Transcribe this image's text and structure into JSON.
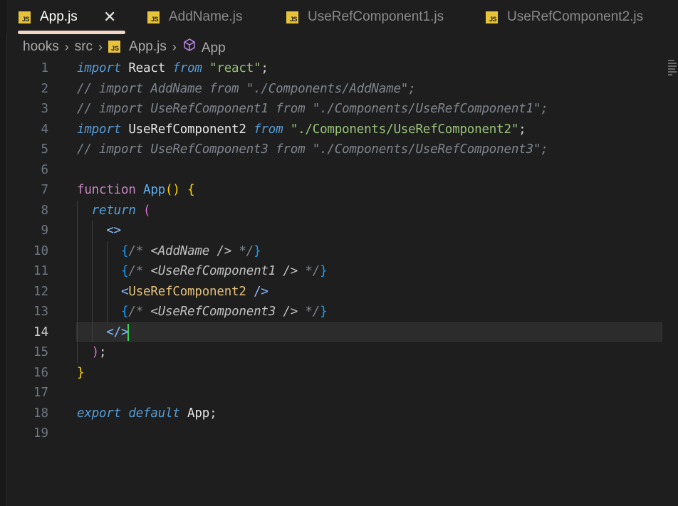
{
  "tabs": [
    {
      "label": "App.js",
      "icon": "js-file-icon",
      "badge": "JS",
      "active": true,
      "close": "✕"
    },
    {
      "label": "AddName.js",
      "icon": "js-file-icon",
      "badge": "JS",
      "active": false
    },
    {
      "label": "UseRefComponent1.js",
      "icon": "js-file-icon",
      "badge": "JS",
      "active": false
    },
    {
      "label": "UseRefComponent2.js",
      "icon": "js-file-icon",
      "badge": "JS",
      "active": false
    }
  ],
  "breadcrumb": {
    "items": [
      "hooks",
      "src",
      "App.js",
      "App"
    ],
    "separator": "›",
    "file_badge": "JS"
  },
  "editor": {
    "current_line": 14,
    "line_numbers": [
      "1",
      "2",
      "3",
      "4",
      "5",
      "6",
      "7",
      "8",
      "9",
      "10",
      "11",
      "12",
      "13",
      "14",
      "15",
      "16",
      "17",
      "18",
      "19"
    ],
    "lines": [
      [
        [
          "kw-it",
          "import"
        ],
        [
          "id",
          " React "
        ],
        [
          "kw-it",
          "from"
        ],
        [
          "str",
          " \"react\""
        ],
        [
          "punc",
          ";"
        ]
      ],
      [
        [
          "com",
          "// import AddName from \"./Components/AddName\";"
        ]
      ],
      [
        [
          "com",
          "// import UseRefComponent1 from \"./Components/UseRefComponent1\";"
        ]
      ],
      [
        [
          "kw-it",
          "import"
        ],
        [
          "id",
          " UseRefComponent2 "
        ],
        [
          "kw-it",
          "from"
        ],
        [
          "str",
          " \"./Components/UseRefComponent2\""
        ],
        [
          "punc",
          ";"
        ]
      ],
      [
        [
          "com",
          "// import UseRefComponent3 from \"./Components/UseRefComponent3\";"
        ]
      ],
      [],
      [
        [
          "fn",
          "function"
        ],
        [
          "id",
          " "
        ],
        [
          "fname",
          "App"
        ],
        [
          "br-y",
          "()"
        ],
        [
          "id",
          " "
        ],
        [
          "br-y",
          "{"
        ]
      ],
      [
        [
          "id",
          "  "
        ],
        [
          "kw-it",
          "return"
        ],
        [
          "id",
          " "
        ],
        [
          "br-p",
          "("
        ]
      ],
      [
        [
          "id",
          "    "
        ],
        [
          "tagp",
          "<>"
        ]
      ],
      [
        [
          "id",
          "      "
        ],
        [
          "br-b",
          "{"
        ],
        [
          "com",
          "/* "
        ],
        [
          "comtxt",
          "<AddName />"
        ],
        [
          "com",
          " */"
        ],
        [
          "br-b",
          "}"
        ]
      ],
      [
        [
          "id",
          "      "
        ],
        [
          "br-b",
          "{"
        ],
        [
          "com",
          "/* "
        ],
        [
          "comtxt",
          "<UseRefComponent1 />"
        ],
        [
          "com",
          " */"
        ],
        [
          "br-b",
          "}"
        ]
      ],
      [
        [
          "id",
          "      "
        ],
        [
          "tagp",
          "<"
        ],
        [
          "tag",
          "UseRefComponent2"
        ],
        [
          "id",
          " "
        ],
        [
          "tagp",
          "/>"
        ]
      ],
      [
        [
          "id",
          "      "
        ],
        [
          "br-b",
          "{"
        ],
        [
          "com",
          "/* "
        ],
        [
          "comtxt",
          "<UseRefComponent3 />"
        ],
        [
          "com",
          " */"
        ],
        [
          "br-b",
          "}"
        ]
      ],
      [
        [
          "id",
          "    "
        ],
        [
          "tagp",
          "</>"
        ]
      ],
      [
        [
          "id",
          "  "
        ],
        [
          "br-p",
          ")"
        ],
        [
          "punc",
          ";"
        ]
      ],
      [
        [
          "br-y",
          "}"
        ]
      ],
      [],
      [
        [
          "kw-it",
          "export"
        ],
        [
          "id",
          " "
        ],
        [
          "kw-it",
          "default"
        ],
        [
          "id",
          " App"
        ],
        [
          "punc",
          ";"
        ]
      ],
      []
    ]
  },
  "colors": {
    "background": "#1e1e1e",
    "js_badge": "#e8c33a",
    "cursor": "#39d353",
    "keyword": "#569cd6",
    "string": "#98c379",
    "comment": "#7f848e"
  }
}
